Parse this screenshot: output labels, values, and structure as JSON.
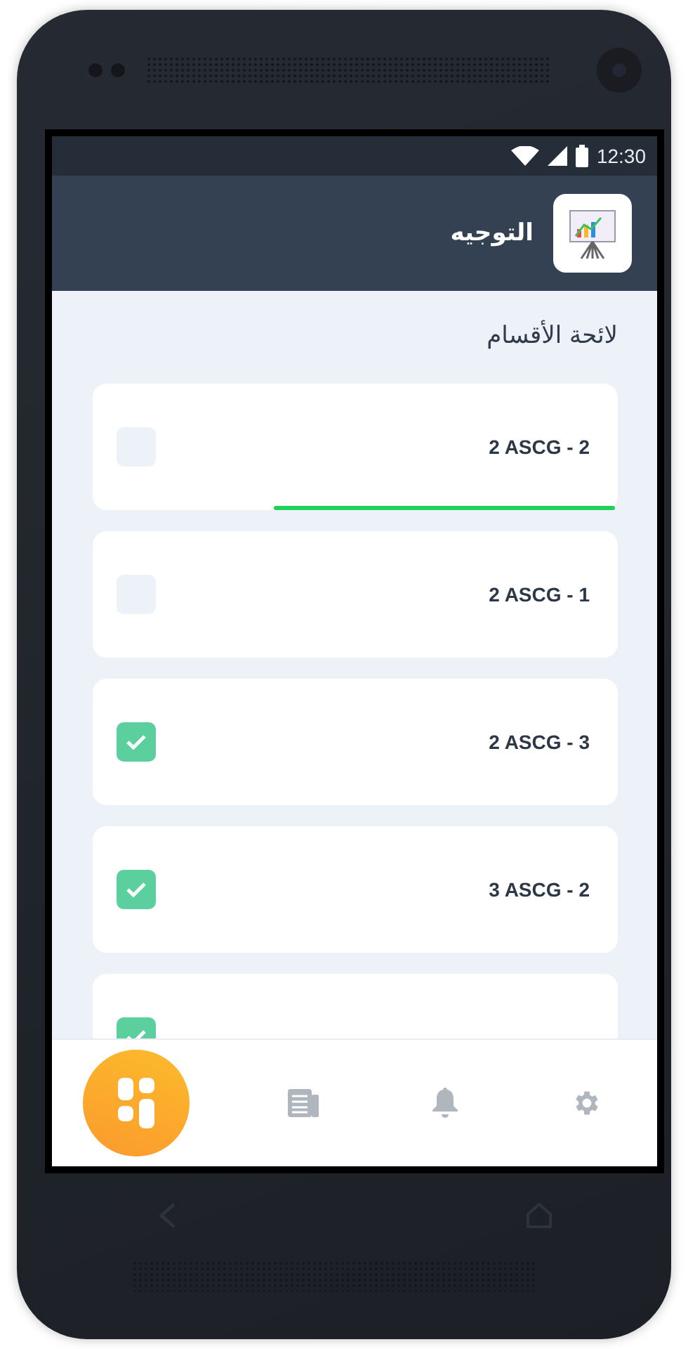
{
  "status_bar": {
    "time": "12:30"
  },
  "header": {
    "title": "التوجيه"
  },
  "section_title": "لائحة الأقسام",
  "classes": [
    {
      "label": "2 ASCG - 2",
      "checked": false,
      "level": 0.65
    },
    {
      "label": "2 ASCG - 1",
      "checked": false
    },
    {
      "label": "2 ASCG - 3",
      "checked": true
    },
    {
      "label": "3 ASCG - 2",
      "checked": true
    },
    {
      "checked": true
    }
  ],
  "bottom_nav": [
    {
      "kind": "home",
      "selected": true
    },
    {
      "kind": "news",
      "selected": false
    },
    {
      "kind": "bell",
      "selected": false
    },
    {
      "kind": "settings",
      "selected": false
    }
  ]
}
